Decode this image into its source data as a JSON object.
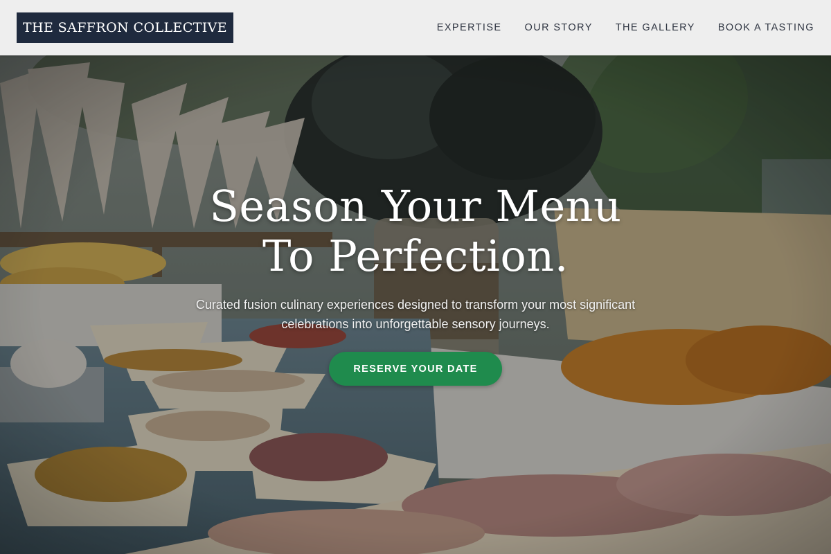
{
  "header": {
    "brand": "THE SAFFRON COLLECTIVE",
    "nav": [
      {
        "label": "EXPERTISE"
      },
      {
        "label": "OUR STORY"
      },
      {
        "label": "THE GALLERY"
      },
      {
        "label": "BOOK A TASTING"
      }
    ]
  },
  "hero": {
    "headline_line1": "Season Your Menu",
    "headline_line2": "To Perfection.",
    "subtitle": "Curated fusion culinary experiences designed to transform your most significant celebrations into unforgettable sensory journeys.",
    "cta_label": "RESERVE YOUR DATE",
    "background_image": "outdoor-catering-buffet-photo"
  },
  "colors": {
    "brand_bg": "#1f2a3e",
    "header_bg": "#f6f6f6",
    "nav_text": "#2f3542",
    "cta_bg": "#1f8b4d",
    "hero_text": "#ffffff"
  }
}
